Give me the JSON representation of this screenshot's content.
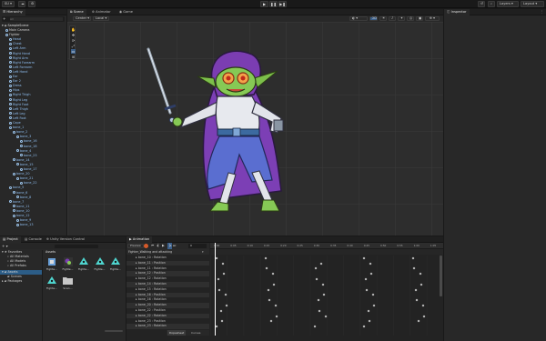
{
  "topbar": {
    "account": "SU",
    "cloud_icon": "cloud-icon",
    "search_icon": "search-icon",
    "layers_label": "Layers",
    "layout_label": "Layout"
  },
  "hierarchy": {
    "tab_label": "Hierarchy",
    "add_label": "+",
    "search_placeholder": "All",
    "scene_name": "SampleScene",
    "items": [
      {
        "label": "Main Camera",
        "indent": 1,
        "blue": false
      },
      {
        "label": "Fighter",
        "indent": 1,
        "blue": false
      },
      {
        "label": "Head",
        "indent": 2,
        "blue": true
      },
      {
        "label": "Chest",
        "indent": 2,
        "blue": true
      },
      {
        "label": "Left Arm",
        "indent": 2,
        "blue": true
      },
      {
        "label": "Right Hand",
        "indent": 2,
        "blue": true
      },
      {
        "label": "Right Arm",
        "indent": 2,
        "blue": true
      },
      {
        "label": "Right Forearm",
        "indent": 2,
        "blue": true
      },
      {
        "label": "Left Forearm",
        "indent": 2,
        "blue": true
      },
      {
        "label": "Left Hand",
        "indent": 2,
        "blue": true
      },
      {
        "label": "Ear",
        "indent": 2,
        "blue": true
      },
      {
        "label": "Ear 2",
        "indent": 2,
        "blue": true
      },
      {
        "label": "Dress",
        "indent": 2,
        "blue": true
      },
      {
        "label": "Hips",
        "indent": 2,
        "blue": true
      },
      {
        "label": "Right Thigh",
        "indent": 2,
        "blue": true
      },
      {
        "label": "Right Leg",
        "indent": 2,
        "blue": true
      },
      {
        "label": "Right Foot",
        "indent": 2,
        "blue": true
      },
      {
        "label": "Left Thigh",
        "indent": 2,
        "blue": true
      },
      {
        "label": "Left Leg",
        "indent": 2,
        "blue": true
      },
      {
        "label": "Left Foot",
        "indent": 2,
        "blue": true
      },
      {
        "label": "Cape",
        "indent": 2,
        "blue": true
      },
      {
        "label": "bone_1",
        "indent": 2,
        "blue": true
      },
      {
        "label": "bone_2",
        "indent": 3,
        "blue": true
      },
      {
        "label": "bone_3",
        "indent": 4,
        "blue": true
      },
      {
        "label": "bone_16",
        "indent": 5,
        "blue": true
      },
      {
        "label": "bone_18",
        "indent": 5,
        "blue": true
      },
      {
        "label": "bone_4",
        "indent": 4,
        "blue": true
      },
      {
        "label": "bone_23",
        "indent": 5,
        "blue": true
      },
      {
        "label": "bone_14",
        "indent": 3,
        "blue": true
      },
      {
        "label": "bone_15",
        "indent": 4,
        "blue": true
      },
      {
        "label": "bone_17",
        "indent": 5,
        "blue": true
      },
      {
        "label": "bone_20",
        "indent": 3,
        "blue": true
      },
      {
        "label": "bone_21",
        "indent": 4,
        "blue": true
      },
      {
        "label": "bone_22",
        "indent": 5,
        "blue": true
      },
      {
        "label": "bone_5",
        "indent": 2,
        "blue": true
      },
      {
        "label": "bone_6",
        "indent": 3,
        "blue": true
      },
      {
        "label": "bone_8",
        "indent": 4,
        "blue": true
      },
      {
        "label": "bone_7",
        "indent": 2,
        "blue": true
      },
      {
        "label": "bone_11",
        "indent": 3,
        "blue": true
      },
      {
        "label": "bone_10",
        "indent": 3,
        "blue": true
      },
      {
        "label": "bone_12",
        "indent": 3,
        "blue": true
      },
      {
        "label": "bone_9",
        "indent": 4,
        "blue": true
      },
      {
        "label": "bone_13",
        "indent": 4,
        "blue": true
      }
    ]
  },
  "center_tabs": {
    "scene": "Scene",
    "animator": "Animator",
    "game": "Game"
  },
  "scene_toolbar": {
    "pivot": "Center",
    "space": "Local",
    "mode_2d": "2D"
  },
  "inspector": {
    "tab_label": "Inspector"
  },
  "project": {
    "tab_project": "Project",
    "tab_console": "Console",
    "tab_vc": "Unity Version Control",
    "favorites": "Favorites",
    "fav_items": [
      "All Materials",
      "All Models",
      "All Prefabs"
    ],
    "assets_root": "Assets",
    "assets_children": [
      "Scenes"
    ],
    "packages": "Packages",
    "breadcrumb": "Assets",
    "assets": [
      {
        "label": "Fighte...",
        "kind": "prefab"
      },
      {
        "label": "Fighte...",
        "kind": "sprite"
      },
      {
        "label": "Fighte...",
        "kind": "anim"
      },
      {
        "label": "Fighte...",
        "kind": "anim"
      },
      {
        "label": "Fighte...",
        "kind": "anim"
      },
      {
        "label": "Fighte...",
        "kind": "anim"
      },
      {
        "label": "Scen...",
        "kind": "folder"
      }
    ]
  },
  "animation": {
    "tab_label": "Animation",
    "preview": "Preview",
    "frame": "0",
    "clip": "Fighter_Walking and attacking",
    "tab_dopesheet": "Dopesheet",
    "tab_curves": "Curves",
    "ruler": [
      "0:00",
      "0:05",
      "0:10",
      "0:15",
      "0:20",
      "0:25",
      "0:30",
      "0:35",
      "0:40",
      "0:45",
      "0:50",
      "0:55",
      "1:00",
      "1:05"
    ],
    "rows": [
      "▸ bone_10 : Rotation",
      "▸ bone_11 : Position",
      "▸ bone_11 : Rotation",
      "▸ bone_12 : Position",
      "▸ bone_12 : Rotation",
      "▸ bone_14 : Rotation",
      "▸ bone_15 : Rotation",
      "▸ bone_16 : Position",
      "▸ bone_16 : Rotation",
      "▸ bone_20 : Rotation",
      "▸ bone_22 : Position",
      "▸ bone_22 : Rotation",
      "▸ bone_23 : Position",
      "▸ bone_23 : Rotation"
    ]
  }
}
